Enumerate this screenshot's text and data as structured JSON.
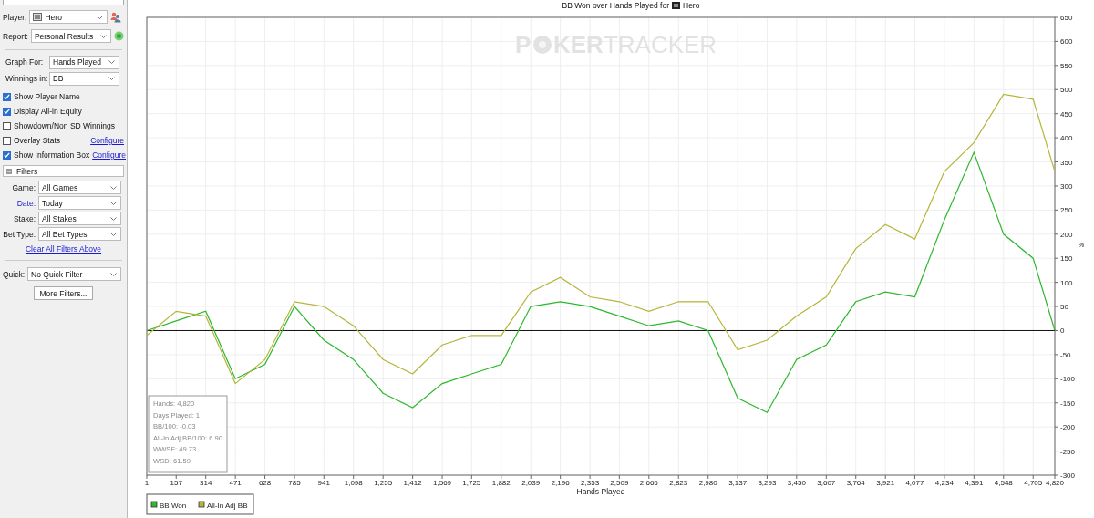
{
  "sidebar": {
    "player": {
      "label": "Player:",
      "value": "Hero"
    },
    "report": {
      "label": "Report:",
      "value": "Personal Results"
    },
    "graph_for": {
      "label": "Graph For:",
      "value": "Hands Played"
    },
    "winnings_in": {
      "label": "Winnings in:",
      "value": "BB"
    },
    "options": [
      {
        "label": "Show Player Name",
        "checked": true
      },
      {
        "label": "Display All-in Equity",
        "checked": true
      },
      {
        "label": "Showdown/Non SD Winnings",
        "checked": false
      },
      {
        "label": "Overlay Stats",
        "checked": false,
        "link": "Configure"
      },
      {
        "label": "Show Information Box",
        "checked": true,
        "link": "Configure"
      }
    ],
    "filters": {
      "title": "Filters",
      "expanded": true,
      "fields": [
        {
          "label": "Game:",
          "value": "All Games",
          "active": false
        },
        {
          "label": "Date:",
          "value": "Today",
          "active": true
        },
        {
          "label": "Stake:",
          "value": "All Stakes",
          "active": false
        },
        {
          "label": "Bet Type:",
          "value": "All Bet Types",
          "active": false
        }
      ],
      "clear_link": "Clear All Filters Above"
    },
    "quick": {
      "label": "Quick:",
      "value": "No Quick Filter"
    },
    "more_button": "More Filters..."
  },
  "chart": {
    "title": "BB Won over Hands Played for",
    "player": "Hero",
    "logo": {
      "before": "P",
      "after": "KER",
      "second": "TRACKER"
    },
    "y_unit": "%",
    "info_box": [
      "Hands: 4,820",
      "Days Played: 1",
      "BB/100: -0.03",
      "All-In Adj BB/100: 6.90",
      "WWSF: 49.73",
      "WSD: 61.59"
    ],
    "chart_data": {
      "type": "line",
      "xlabel": "Hands Played",
      "x": [
        1,
        157,
        314,
        471,
        628,
        785,
        941,
        1098,
        1255,
        1412,
        1569,
        1725,
        1882,
        2039,
        2196,
        2353,
        2509,
        2666,
        2823,
        2980,
        3137,
        3293,
        3450,
        3607,
        3764,
        3921,
        4077,
        4234,
        4391,
        4548,
        4705,
        4820
      ],
      "series": [
        {
          "name": "BB Won",
          "color": "#2db82d",
          "values": [
            0,
            20,
            40,
            -100,
            -70,
            50,
            -20,
            -60,
            -130,
            -160,
            -110,
            -90,
            -70,
            50,
            60,
            50,
            30,
            10,
            20,
            0,
            -140,
            -170,
            -60,
            -30,
            60,
            80,
            70,
            230,
            370,
            200,
            150,
            0
          ]
        },
        {
          "name": "All-In Adj BB",
          "color": "#b5b53a",
          "values": [
            -10,
            40,
            30,
            -110,
            -60,
            60,
            50,
            10,
            -60,
            -90,
            -30,
            -10,
            -10,
            80,
            110,
            70,
            60,
            40,
            60,
            60,
            -40,
            -20,
            30,
            70,
            170,
            220,
            190,
            330,
            390,
            490,
            480,
            330
          ]
        }
      ],
      "grid": true,
      "legend": "bottom-left",
      "xlim": [
        1,
        4820
      ],
      "ylim": [
        -300,
        650
      ],
      "xticks": [
        1,
        157,
        314,
        471,
        628,
        785,
        941,
        {
          "value": 1098,
          "label": "1,098"
        },
        {
          "value": 1255,
          "label": "1,255"
        },
        {
          "value": 1412,
          "label": "1,412"
        },
        {
          "value": 1569,
          "label": "1,569"
        },
        {
          "value": 1725,
          "label": "1,725"
        },
        {
          "value": 1882,
          "label": "1,882"
        },
        {
          "value": 2039,
          "label": "2,039"
        },
        {
          "value": 2196,
          "label": "2,196"
        },
        {
          "value": 2353,
          "label": "2,353"
        },
        {
          "value": 2509,
          "label": "2,509"
        },
        {
          "value": 2666,
          "label": "2,666"
        },
        {
          "value": 2823,
          "label": "2,823"
        },
        {
          "value": 2980,
          "label": "2,980"
        },
        {
          "value": 3137,
          "label": "3,137"
        },
        {
          "value": 3293,
          "label": "3,293"
        },
        {
          "value": 3450,
          "label": "3,450"
        },
        {
          "value": 3607,
          "label": "3,607"
        },
        {
          "value": 3764,
          "label": "3,764"
        },
        {
          "value": 3921,
          "label": "3,921"
        },
        {
          "value": 4077,
          "label": "4,077"
        },
        {
          "value": 4234,
          "label": "4,234"
        },
        {
          "value": 4391,
          "label": "4,391"
        },
        {
          "value": 4548,
          "label": "4,548"
        },
        {
          "value": 4705,
          "label": "4,705"
        },
        {
          "value": 4820,
          "label": "4,820"
        }
      ],
      "yticks": [
        650,
        600,
        550,
        500,
        450,
        400,
        350,
        300,
        250,
        200,
        150,
        100,
        50,
        0,
        -50,
        -100,
        -150,
        -200,
        -250,
        -300
      ]
    }
  }
}
